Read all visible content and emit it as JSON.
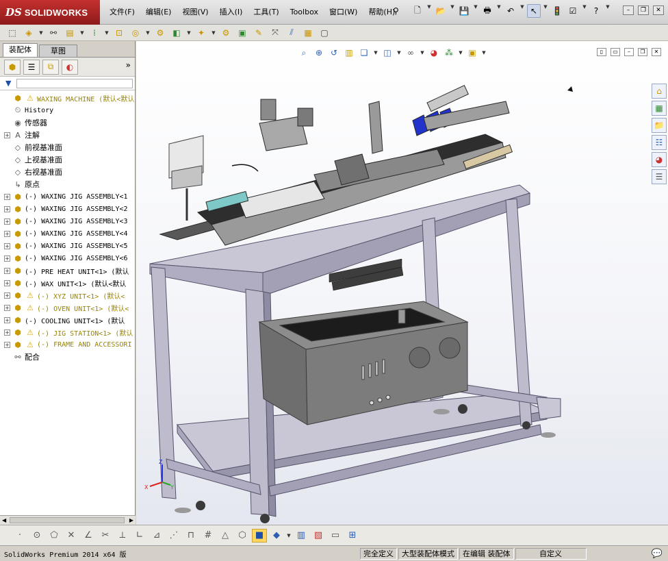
{
  "app": {
    "logo_ds": "DS",
    "logo_name": "SOLIDWORKS"
  },
  "menu": [
    "文件(F)",
    "编辑(E)",
    "视图(V)",
    "插入(I)",
    "工具(T)",
    "Toolbox",
    "窗口(W)",
    "帮助(H)"
  ],
  "tabs": {
    "assembly": "装配体",
    "sketch": "草图"
  },
  "tree": [
    {
      "label": "WAXING MACHINE  (默认<默认",
      "icon": "assembly-icon",
      "warn": true,
      "expand": false,
      "zh": false
    },
    {
      "label": "History",
      "icon": "history-icon",
      "warn": false,
      "expand": false,
      "zh": false
    },
    {
      "label": "传感器",
      "icon": "sensor-icon",
      "warn": false,
      "expand": false,
      "zh": true
    },
    {
      "label": "注解",
      "icon": "annotation-icon",
      "warn": false,
      "expand": true,
      "zh": true
    },
    {
      "label": "前视基准面",
      "icon": "plane-icon",
      "warn": false,
      "expand": false,
      "zh": true
    },
    {
      "label": "上视基准面",
      "icon": "plane-icon",
      "warn": false,
      "expand": false,
      "zh": true
    },
    {
      "label": "右视基准面",
      "icon": "plane-icon",
      "warn": false,
      "expand": false,
      "zh": true
    },
    {
      "label": "原点",
      "icon": "origin-icon",
      "warn": false,
      "expand": false,
      "zh": true
    },
    {
      "label": "(-) WAXING JIG ASSEMBLY<1",
      "icon": "assembly-icon",
      "warn": false,
      "expand": true,
      "zh": false
    },
    {
      "label": "(-) WAXING JIG ASSEMBLY<2",
      "icon": "assembly-icon",
      "warn": false,
      "expand": true,
      "zh": false
    },
    {
      "label": "(-) WAXING JIG ASSEMBLY<3",
      "icon": "assembly-icon",
      "warn": false,
      "expand": true,
      "zh": false
    },
    {
      "label": "(-) WAXING JIG ASSEMBLY<4",
      "icon": "assembly-icon",
      "warn": false,
      "expand": true,
      "zh": false
    },
    {
      "label": "(-) WAXING JIG ASSEMBLY<5",
      "icon": "assembly-icon",
      "warn": false,
      "expand": true,
      "zh": false
    },
    {
      "label": "(-) WAXING JIG ASSEMBLY<6",
      "icon": "assembly-icon",
      "warn": false,
      "expand": true,
      "zh": false
    },
    {
      "label": "(-) PRE HEAT UNIT<1> (默认",
      "icon": "assembly-icon",
      "warn": false,
      "expand": true,
      "zh": false
    },
    {
      "label": "(-) WAX UNIT<1> (默认<默认",
      "icon": "assembly-icon",
      "warn": false,
      "expand": true,
      "zh": false
    },
    {
      "label": "(-) XYZ UNIT<1> (默认<",
      "icon": "assembly-icon",
      "warn": true,
      "expand": true,
      "zh": false
    },
    {
      "label": "(-) OVEN UNIT<1> (默认<",
      "icon": "assembly-icon",
      "warn": true,
      "expand": true,
      "zh": false
    },
    {
      "label": "(-) COOLING UNIT<1> (默认",
      "icon": "assembly-icon",
      "warn": false,
      "expand": true,
      "zh": false
    },
    {
      "label": "(-) JIG STATION<1> (默认",
      "icon": "assembly-icon",
      "warn": true,
      "expand": true,
      "zh": false
    },
    {
      "label": "(-) FRAME AND ACCESSORI",
      "icon": "assembly-icon",
      "warn": true,
      "expand": true,
      "zh": false
    },
    {
      "label": "配合",
      "icon": "mates-icon",
      "warn": false,
      "expand": false,
      "zh": true
    }
  ],
  "status": {
    "product": "SolidWorks Premium 2014 x64 版",
    "constraint": "完全定义",
    "mode": "大型装配体模式",
    "editing": "在编辑 装配体",
    "units": "自定义"
  },
  "triad": {
    "z": "Z",
    "x": "X",
    "y": "Y"
  },
  "colors": {
    "logo_red": "#b02826",
    "frame": "#b9b6c9",
    "warn": "#d8a800",
    "accent_blue": "#2b5fb3"
  }
}
